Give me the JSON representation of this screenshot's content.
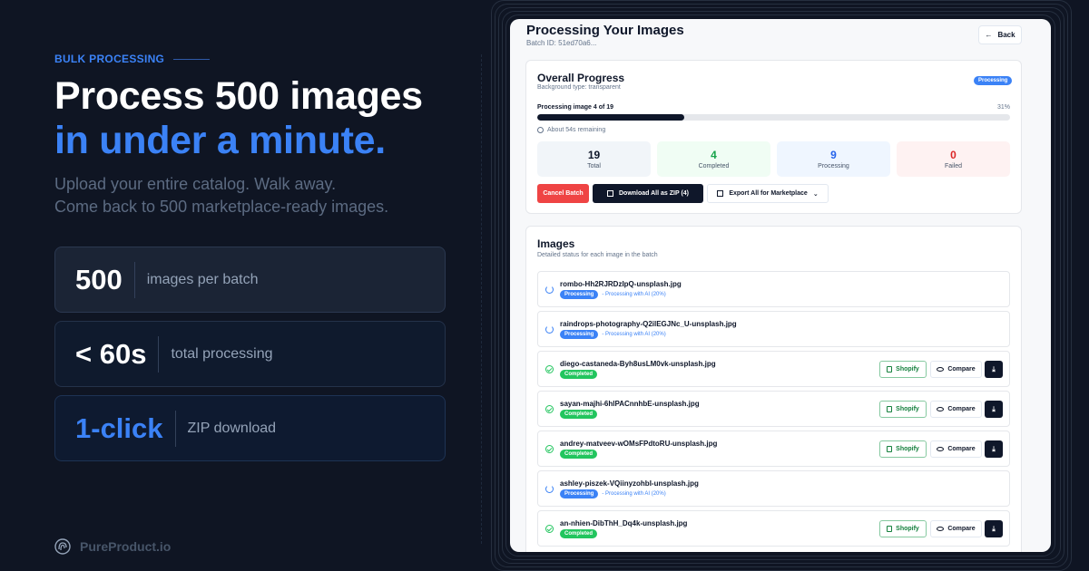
{
  "left": {
    "eyebrow": "BULK PROCESSING",
    "headline_line1": "Process 500 images",
    "headline_line2": "in under a minute.",
    "sub_line1": "Upload your entire catalog. Walk away.",
    "sub_line2": "Come back to 500 marketplace-ready images.",
    "stats": [
      {
        "value": "500",
        "label": "images per batch"
      },
      {
        "value": "< 60s",
        "label": "total processing"
      },
      {
        "value": "1-click",
        "label": "ZIP download"
      }
    ],
    "brand": "PureProduct.io"
  },
  "colors": {
    "accent": "#3b82f6",
    "background": "#0f1523",
    "success": "#22c55e",
    "danger": "#ef4444"
  },
  "panel": {
    "title": "Processing Your Images",
    "batch_id": "Batch ID: 51ed70a6...",
    "back_label": "Back",
    "overall": {
      "title": "Overall Progress",
      "subtitle": "Background type: transparent",
      "badge": "Processing",
      "progress_label": "Processing image 4 of 19",
      "progress_pct_text": "31%",
      "progress_fraction": 0.31,
      "eta": "About 54s remaining",
      "tiles": [
        {
          "value": "19",
          "label": "Total"
        },
        {
          "value": "4",
          "label": "Completed"
        },
        {
          "value": "9",
          "label": "Processing"
        },
        {
          "value": "0",
          "label": "Failed"
        }
      ],
      "cancel_label": "Cancel Batch",
      "download_label": "Download All as ZIP (4)",
      "export_label": "Export All for Marketplace"
    },
    "images": {
      "title": "Images",
      "subtitle": "Detailed status for each image in the batch",
      "shopify_label": "Shopify",
      "compare_label": "Compare",
      "rows": [
        {
          "name": "rombo-Hh2RJRDzIpQ-unsplash.jpg",
          "status": "Processing",
          "note": "- Processing with AI (20%)"
        },
        {
          "name": "raindrops-photography-Q2ilEGJNc_U-unsplash.jpg",
          "status": "Processing",
          "note": "- Processing with AI (20%)"
        },
        {
          "name": "diego-castaneda-Byh8usLM0vk-unsplash.jpg",
          "status": "Completed",
          "note": ""
        },
        {
          "name": "sayan-majhi-6hlPACnnhbE-unsplash.jpg",
          "status": "Completed",
          "note": ""
        },
        {
          "name": "andrey-matveev-wOMsFPdtoRU-unsplash.jpg",
          "status": "Completed",
          "note": ""
        },
        {
          "name": "ashley-piszek-VQiinyzohbI-unsplash.jpg",
          "status": "Processing",
          "note": "- Processing with AI (20%)"
        },
        {
          "name": "an-nhien-DibThH_Dq4k-unsplash.jpg",
          "status": "Completed",
          "note": ""
        }
      ]
    }
  }
}
